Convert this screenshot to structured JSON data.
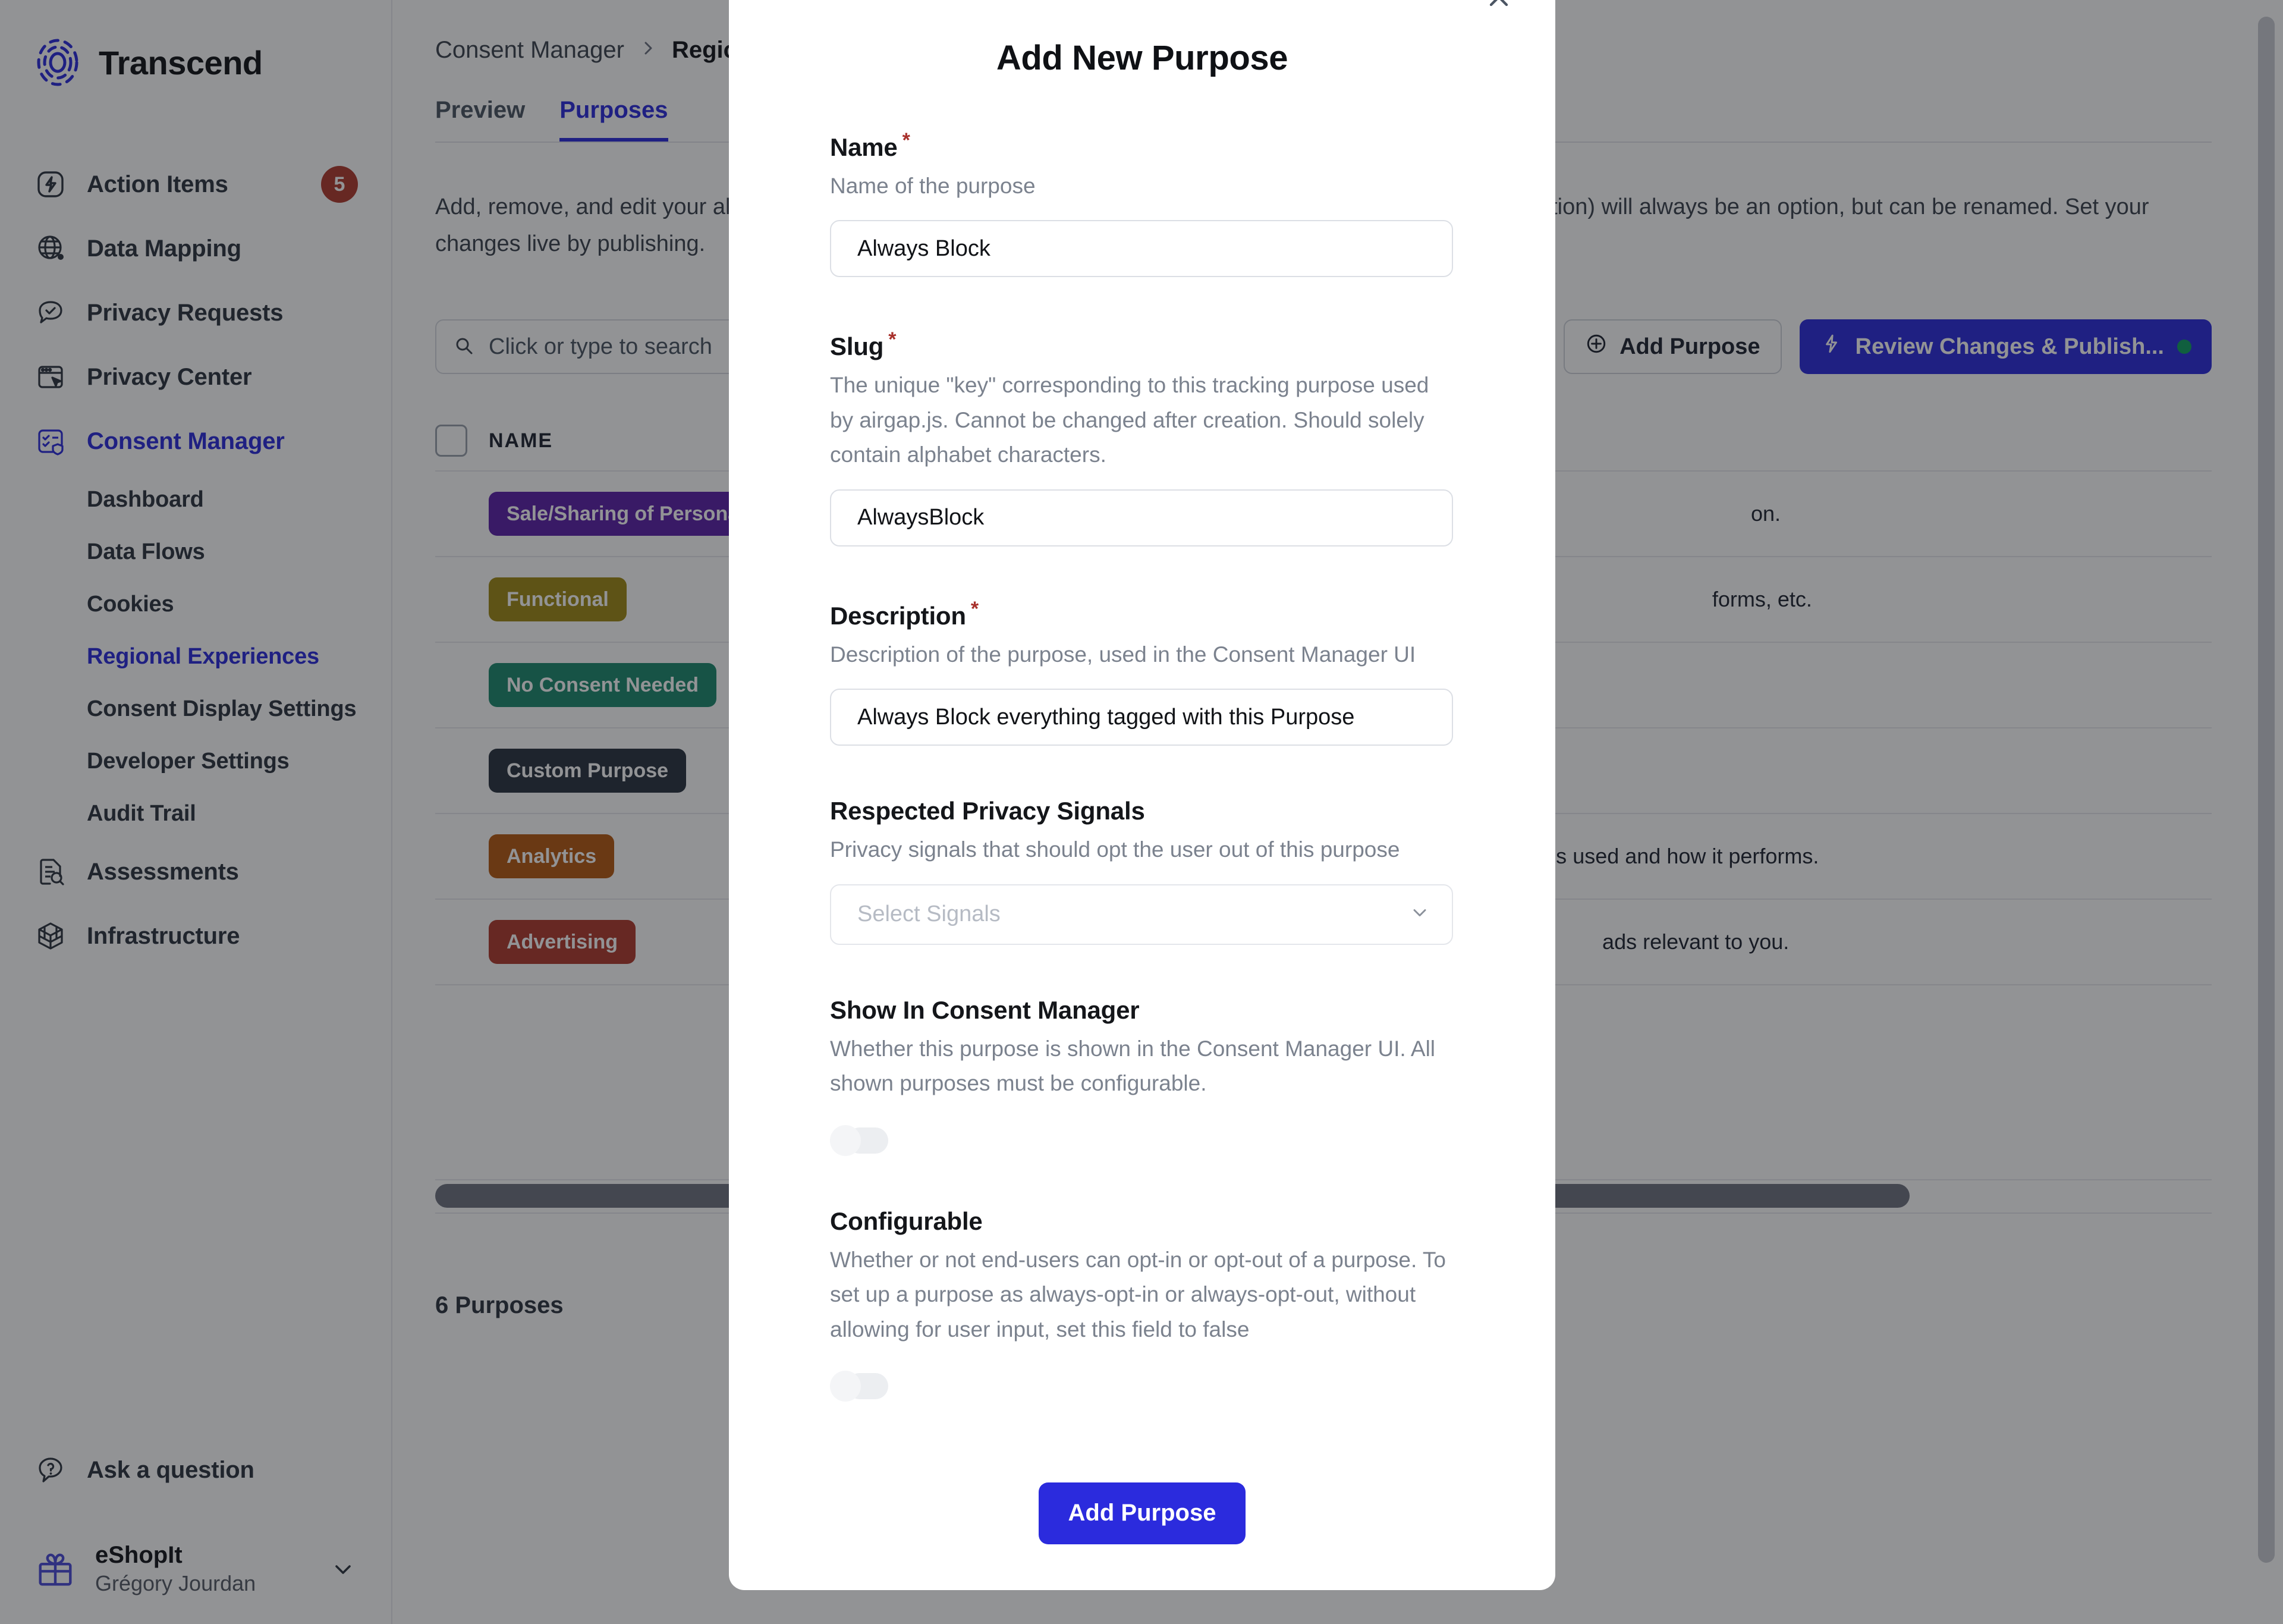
{
  "brand": {
    "name": "Transcend",
    "logo_icon": "transcend-fingerprint-logo"
  },
  "sidebar": {
    "items": [
      {
        "label": "Action Items",
        "icon": "bolt-icon",
        "badge": "5",
        "active": false
      },
      {
        "label": "Data Mapping",
        "icon": "globe-icon",
        "active": false
      },
      {
        "label": "Privacy Requests",
        "icon": "chat-check-icon",
        "active": false
      },
      {
        "label": "Privacy Center",
        "icon": "browser-cursor-icon",
        "active": false
      },
      {
        "label": "Consent Manager",
        "icon": "consent-shield-icon",
        "active": true
      }
    ],
    "consent_children": [
      {
        "label": "Dashboard",
        "active": false
      },
      {
        "label": "Data Flows",
        "active": false
      },
      {
        "label": "Cookies",
        "active": false
      },
      {
        "label": "Regional Experiences",
        "active": true
      },
      {
        "label": "Consent Display Settings",
        "active": false
      },
      {
        "label": "Developer Settings",
        "active": false
      },
      {
        "label": "Audit Trail",
        "active": false
      }
    ],
    "items_after": [
      {
        "label": "Assessments",
        "icon": "assessment-doc-icon"
      },
      {
        "label": "Infrastructure",
        "icon": "cube-icon"
      }
    ],
    "help": {
      "label": "Ask a question",
      "icon": "question-bubble-icon"
    },
    "account": {
      "org": "eShopIt",
      "user": "Grégory Jourdan",
      "icon": "gift-icon",
      "chevron": "chevron-down-icon"
    }
  },
  "breadcrumb": {
    "parent": "Consent Manager",
    "separator": "chevron-right-icon",
    "current": "Regional Experiences"
  },
  "tabs": [
    {
      "label": "Preview",
      "active": false
    },
    {
      "label": "Purposes",
      "active": true
    }
  ],
  "page": {
    "description": "Add, remove, and edit your allowed tracking purposes. The base purposes (Essential, Sale Of Personal Information) will always be an option, but can be renamed. Set your changes live by publishing.",
    "count_label": "6 Purposes"
  },
  "search": {
    "placeholder": "Click or type to search",
    "value": "",
    "icon": "search-icon",
    "clear_icon": "clear-circle-icon"
  },
  "toolbar": {
    "add_purpose_label": "Add Purpose",
    "add_purpose_icon": "plus-circle-icon",
    "publish_label": "Review Changes & Publish...",
    "publish_icon": "lightning-icon",
    "publish_status_dot": "#10a060"
  },
  "table": {
    "select_all": "checkbox-unchecked",
    "columns": [
      "NAME"
    ],
    "rows": [
      {
        "tag": "Sale/Sharing of Personal Information",
        "color": "#5b21a8",
        "desc_tail": "on."
      },
      {
        "tag": "Functional",
        "color": "#a08a15",
        "desc_tail": "forms, etc."
      },
      {
        "tag": "No Consent Needed",
        "color": "#1d8a6e",
        "desc_tail": ""
      },
      {
        "tag": "Custom Purpose",
        "color": "#2a3340",
        "desc_tail": ""
      },
      {
        "tag": "Analytics",
        "color": "#b55a12",
        "desc_tail": "is used and how it performs."
      },
      {
        "tag": "Advertising",
        "color": "#b03a2e",
        "desc_tail": "ads relevant to you."
      }
    ]
  },
  "modal": {
    "title": "Add New Purpose",
    "close_icon": "close-x-icon",
    "fields": [
      {
        "label": "Name",
        "required": "*",
        "help": "Name of the purpose",
        "value": "Always Block",
        "placeholder": ""
      },
      {
        "label": "Slug",
        "required": "*",
        "help": "The unique \"key\" corresponding to this tracking purpose used by airgap.js. Cannot be changed after creation. Should solely contain alphabet characters.",
        "value": "AlwaysBlock",
        "placeholder": ""
      },
      {
        "label": "Description",
        "required": "*",
        "help": "Description of the purpose, used in the Consent Manager UI",
        "value": "Always Block everything tagged with this Purpose",
        "placeholder": ""
      }
    ],
    "signals": {
      "label": "Respected Privacy Signals",
      "help": "Privacy signals that should opt the user out of this purpose",
      "placeholder": "Select Signals",
      "chevron": "chevron-down-icon"
    },
    "toggles": [
      {
        "label": "Show In Consent Manager",
        "help": "Whether this purpose is shown in the Consent Manager UI. All shown purposes must be configurable.",
        "state": "off"
      },
      {
        "label": "Configurable",
        "help": "Whether or not end-users can opt-in or opt-out of a purpose. To set up a purpose as always-opt-in or always-opt-out, without allowing for user input, set this field to false",
        "state": "off"
      }
    ],
    "submit_label": "Add Purpose"
  },
  "colors": {
    "accent": "#2b2bdd",
    "danger": "#b03a2e",
    "text": "#14161a"
  }
}
